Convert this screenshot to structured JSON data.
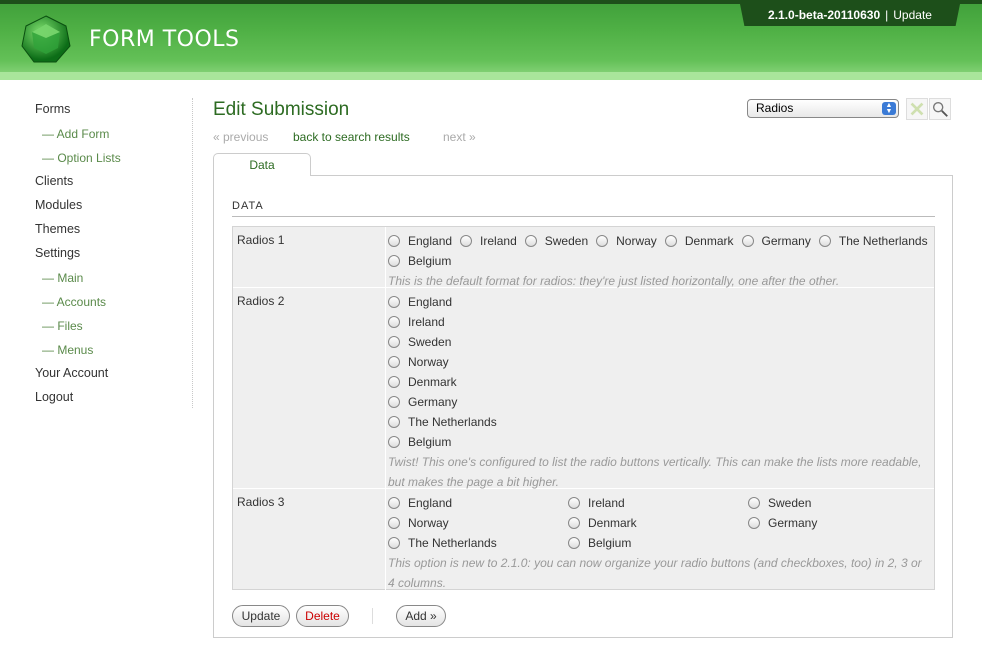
{
  "app": {
    "name": "FORM TOOLS",
    "version": "2.1.0-beta-20110630",
    "separator": "|",
    "update_link": "Update"
  },
  "sidebar": {
    "items": [
      {
        "label": "Forms",
        "type": "main"
      },
      {
        "label": "— Add Form",
        "type": "sub"
      },
      {
        "label": "— Option Lists",
        "type": "sub"
      },
      {
        "label": "Clients",
        "type": "main"
      },
      {
        "label": "Modules",
        "type": "main"
      },
      {
        "label": "Themes",
        "type": "main"
      },
      {
        "label": "Settings",
        "type": "main"
      },
      {
        "label": "— Main",
        "type": "sub"
      },
      {
        "label": "— Accounts",
        "type": "sub"
      },
      {
        "label": "— Files",
        "type": "sub"
      },
      {
        "label": "— Menus",
        "type": "sub"
      },
      {
        "label": "Your Account",
        "type": "main"
      },
      {
        "label": "Logout",
        "type": "main"
      }
    ]
  },
  "main": {
    "title": "Edit Submission",
    "nav": {
      "previous": "« previous",
      "back": "back to search results",
      "next": "next »"
    },
    "view_select": {
      "selected": "Radios"
    },
    "tab": "Data",
    "section_title": "DATA",
    "fields": [
      {
        "label": "Radios 1",
        "options": [
          "England",
          "Ireland",
          "Sweden",
          "Norway",
          "Denmark",
          "Germany",
          "The Netherlands",
          "Belgium"
        ],
        "hint": "This is the default format for radios: they're just listed horizontally, one after the other."
      },
      {
        "label": "Radios 2",
        "options": [
          "England",
          "Ireland",
          "Sweden",
          "Norway",
          "Denmark",
          "Germany",
          "The Netherlands",
          "Belgium"
        ],
        "hint": "Twist! This one's configured to list the radio buttons vertically. This can make the lists more readable, but makes the page a bit higher."
      },
      {
        "label": "Radios 3",
        "options": [
          "England",
          "Ireland",
          "Sweden",
          "Norway",
          "Denmark",
          "Germany",
          "The Netherlands",
          "Belgium"
        ],
        "hint": "This option is new to 2.1.0: you can now organize your radio buttons (and checkboxes, too) in 2, 3 or 4 columns."
      }
    ],
    "buttons": {
      "update": "Update",
      "delete": "Delete",
      "add": "Add »"
    }
  },
  "colors": {
    "header_green": "#4fb045",
    "title_green": "#2d6b22",
    "delete_red": "#cc0000"
  }
}
